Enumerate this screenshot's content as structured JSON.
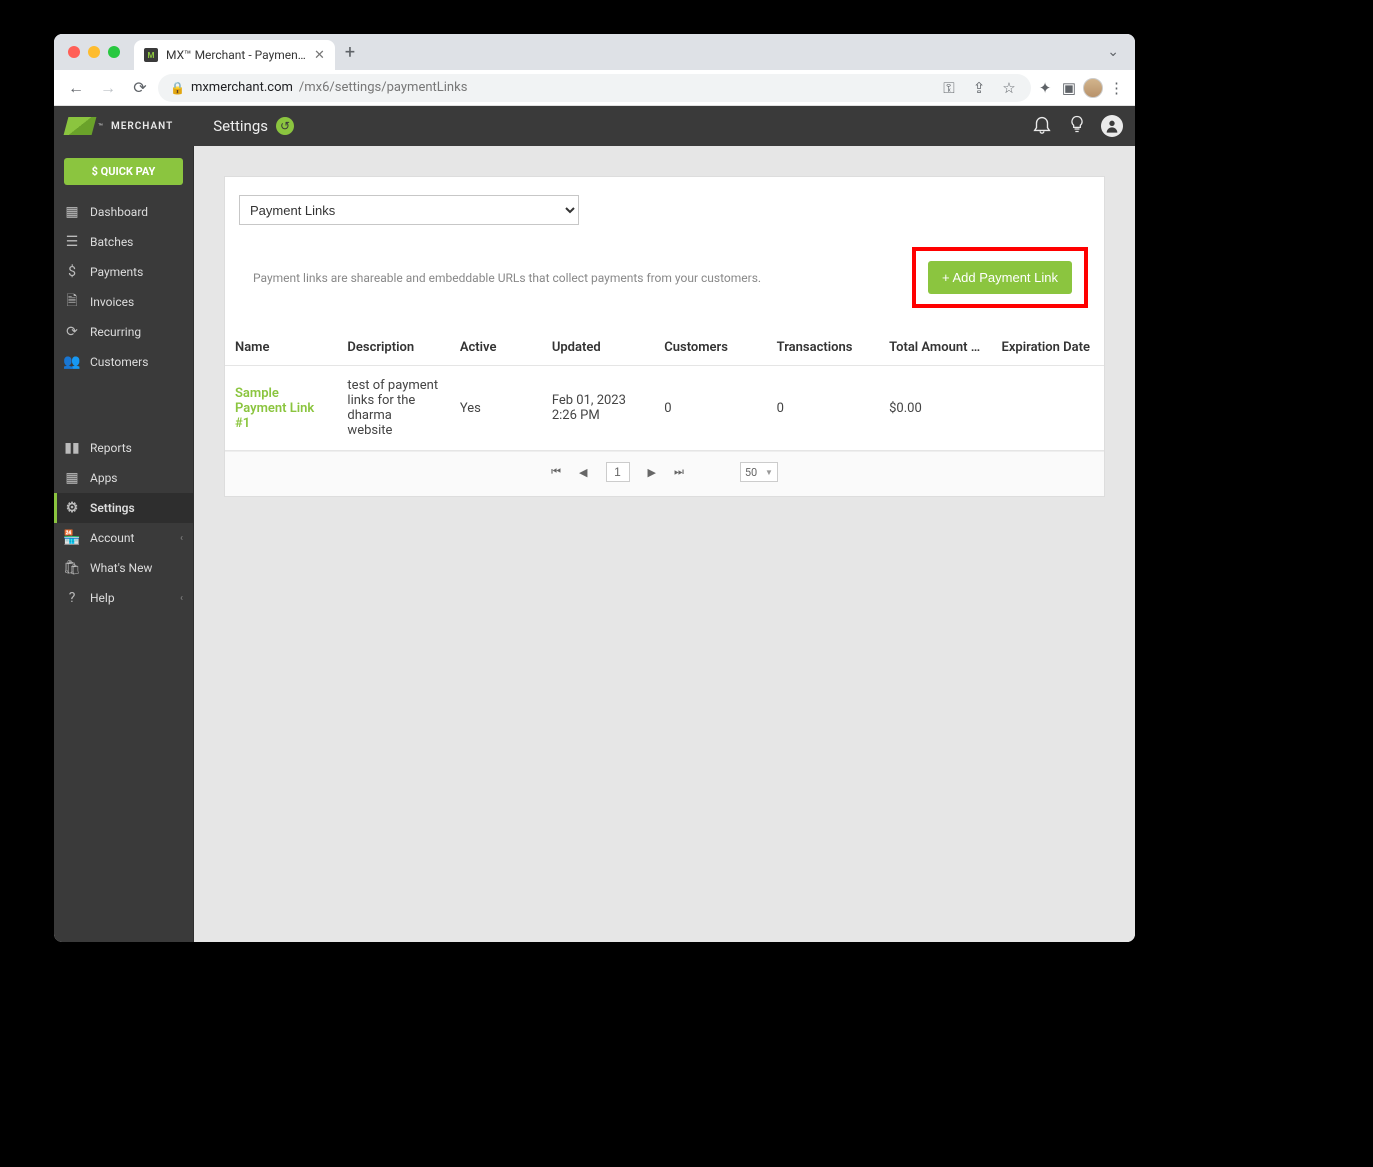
{
  "browser": {
    "tab_title": "MX™ Merchant - Payment Link…",
    "url_host": "mxmerchant.com",
    "url_path": "/mx6/settings/paymentLinks"
  },
  "brand": {
    "name": "MERCHANT",
    "tm": "™"
  },
  "header": {
    "title": "Settings"
  },
  "sidebar": {
    "quick_pay": "$ QUICK PAY",
    "items1": [
      {
        "label": "Dashboard"
      },
      {
        "label": "Batches"
      },
      {
        "label": "Payments"
      },
      {
        "label": "Invoices"
      },
      {
        "label": "Recurring"
      },
      {
        "label": "Customers"
      }
    ],
    "items2": [
      {
        "label": "Reports"
      },
      {
        "label": "Apps"
      },
      {
        "label": "Settings",
        "active": true
      },
      {
        "label": "Account",
        "chevron": true
      },
      {
        "label": "What's New"
      },
      {
        "label": "Help",
        "chevron": true
      }
    ]
  },
  "main": {
    "select_value": "Payment Links",
    "description": "Payment links are shareable and embeddable URLs that collect payments from your customers.",
    "add_button": "+ Add Payment Link",
    "columns": {
      "name": "Name",
      "description": "Description",
      "active": "Active",
      "updated": "Updated",
      "customers": "Customers",
      "transactions": "Transactions",
      "total": "Total Amount P…",
      "expiration": "Expiration Date"
    },
    "rows": [
      {
        "name": "Sample Payment Link #1",
        "description": "test of payment links for the dharma website",
        "active": "Yes",
        "updated": "Feb 01, 2023 2:26 PM",
        "customers": "0",
        "transactions": "0",
        "total": "$0.00",
        "expiration": ""
      }
    ],
    "pager": {
      "page": "1",
      "per_page": "50"
    }
  }
}
